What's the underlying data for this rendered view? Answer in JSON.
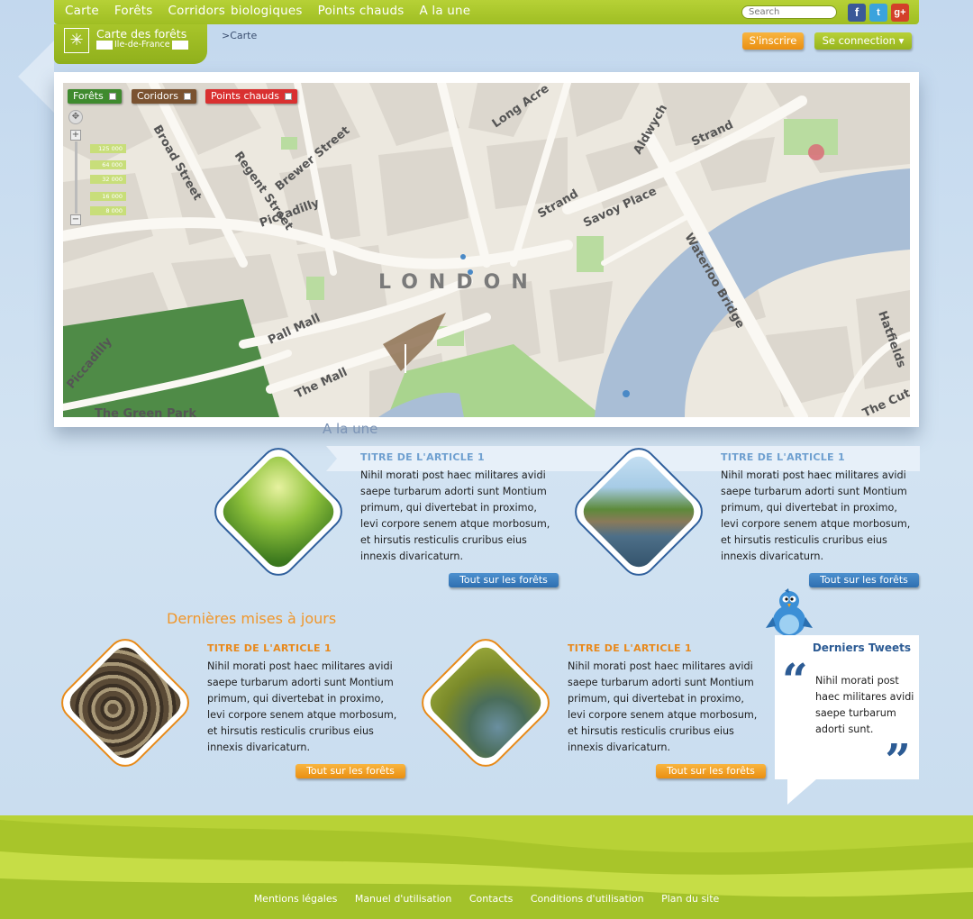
{
  "nav": {
    "items": [
      "Carte",
      "Forêts",
      "Corridors",
      "biologiques",
      "Points chauds",
      "A la une"
    ],
    "search_placeholder": "Search"
  },
  "social": {
    "facebook": "f",
    "twitter": "t",
    "googleplus": "g+"
  },
  "logo": {
    "title": "Carte des forêts",
    "subtitle": "Ile-de-France"
  },
  "breadcrumb": ">Carte",
  "header_buttons": {
    "signup": "S'inscrire",
    "login": "Se connection ▾"
  },
  "map": {
    "layers": [
      "Forêts",
      "Coridors",
      "Points chauds"
    ],
    "scale_labels": [
      "125 000",
      "64 000",
      "32 000",
      "16 000",
      "8 000"
    ],
    "city_label": "LONDON",
    "street_labels": [
      "Brewer Street",
      "Regent Street",
      "Piccadilly",
      "Strand",
      "Long Acre",
      "Aldwych",
      "Savoy Place",
      "Waterloo Bridge",
      "Pall Mall",
      "The Mall",
      "Hatfields",
      "The Green Park",
      "The Cut",
      "Broad Street"
    ],
    "colors": {
      "water": "#a8bfd6",
      "park": "#4c8a44",
      "block": "#dcd7ce",
      "road": "#f7f5f0"
    }
  },
  "a_la_une": {
    "title": "A la une",
    "articles": [
      {
        "title": "TITRE DE L'ARTICLE 1",
        "body": "Nihil morati post haec militares avidi saepe turbarum adorti sunt Montium primum, qui divertebat in proximo, levi corpore senem atque morbosum, et hirsutis resticulis cruribus eius innexis divaricaturn.",
        "button": "Tout sur les forêts"
      },
      {
        "title": "TITRE DE L'ARTICLE 1",
        "body": "Nihil morati post haec militares avidi saepe turbarum adorti sunt Montium primum, qui divertebat in proximo, levi corpore senem atque morbosum, et hirsutis resticulis cruribus eius innexis divaricaturn.",
        "button": "Tout sur les forêts"
      }
    ]
  },
  "updates": {
    "title": "Dernières mises à jours",
    "articles": [
      {
        "title": "TITRE DE L'ARTICLE 1",
        "body": "Nihil morati post haec militares avidi saepe turbarum adorti sunt Montium primum, qui divertebat in proximo, levi corpore senem atque morbosum, et hirsutis resticulis cruribus eius innexis divaricaturn.",
        "button": "Tout sur les forêts"
      },
      {
        "title": "TITRE DE L'ARTICLE 1",
        "body": "Nihil morati post haec militares avidi saepe turbarum adorti sunt Montium primum, qui divertebat in proximo, levi corpore senem atque morbosum, et hirsutis resticulis cruribus eius innexis divaricaturn.",
        "button": "Tout sur les forêts"
      }
    ]
  },
  "tweets": {
    "title": "Derniers Tweets",
    "body": "Nihil morati post haec militares avidi saepe turbarum adorti sunt."
  },
  "footer": {
    "links": [
      "Mentions légales",
      "Manuel d'utilisation",
      "Contacts",
      "Conditions d'utilisation",
      "Plan du site"
    ]
  },
  "colors": {
    "brand_green": "#a8c52a",
    "accent_orange": "#ea8f11",
    "accent_blue": "#2e6fb0"
  }
}
